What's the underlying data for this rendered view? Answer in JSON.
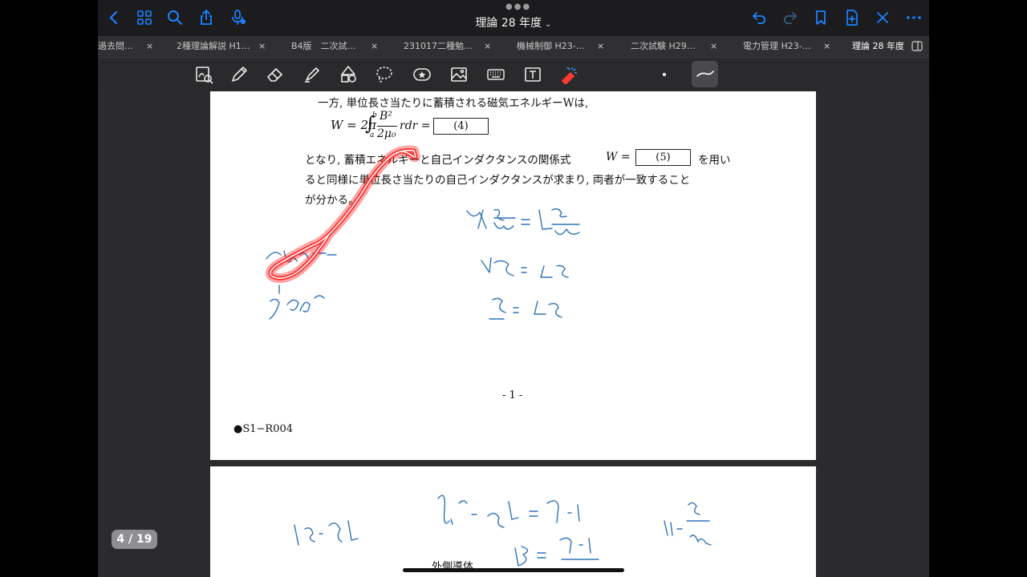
{
  "nav": {
    "title": "理論 28 年度",
    "title_chevron": "⌄"
  },
  "tabs": [
    {
      "label": "過去問…"
    },
    {
      "label": "2種理論解説 H1…"
    },
    {
      "label": "B4版　二次試…"
    },
    {
      "label": "231017二種勉…"
    },
    {
      "label": "機械制御 H23-…"
    },
    {
      "label": "二次試験 H29…"
    },
    {
      "label": "電力管理 H23-…"
    },
    {
      "label": "理論 28 年度"
    }
  ],
  "tab_close": "×",
  "document": {
    "line1": "一方, 単位長さ当たりに蓄積される磁気エネルギーWは,",
    "eq_W": "W = 2π",
    "eq_int_upper": "b",
    "eq_int_lower": "a",
    "eq_num": "B²",
    "eq_den": "2μ₀",
    "eq_tail": "rdr =",
    "blank4": "(4)",
    "line2a": "となり, 蓄積エネルギーと自己インダクタンスの関係式",
    "line2b": "W =",
    "blank5": "(5)",
    "line2c": "を用い",
    "line3": "ると同様に単位長さ当たりの自己インダクタンスが求まり, 両者が一致すること",
    "line4": "が分かる。",
    "page_number": "- 1 -",
    "footer_code": "●S1−R004",
    "page2_caption": "外側導体"
  },
  "page_indicator": "4 / 19",
  "colors": {
    "accent": "#1a84ff",
    "ink_blue": "#2e73b8",
    "laser_red": "#ff1a1a"
  }
}
